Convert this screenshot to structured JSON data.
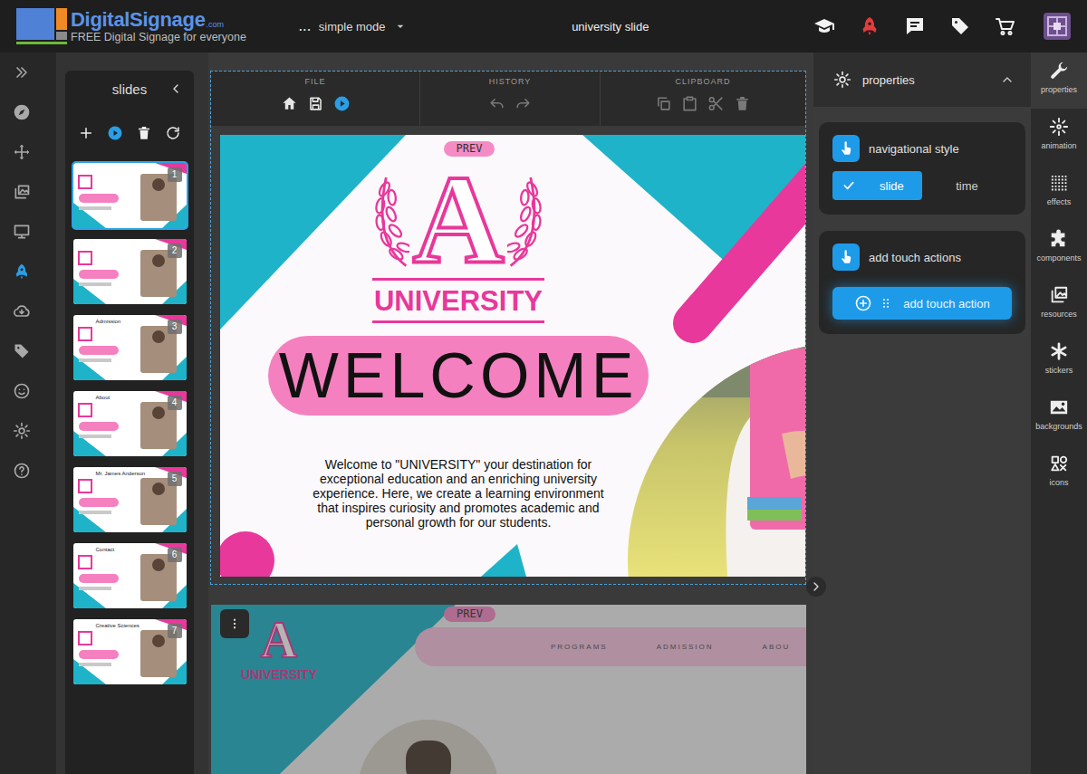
{
  "app": {
    "brand": "DigitalSignage",
    "brand_suffix": ".com",
    "tagline": "FREE Digital Signage for everyone",
    "mode_dots": "...",
    "mode": "simple mode",
    "title": "university slide"
  },
  "nav_rail": {
    "items": [
      {
        "selected": false
      },
      {
        "selected": false
      },
      {
        "selected": false
      },
      {
        "selected": false
      },
      {
        "selected": true
      },
      {
        "selected": false
      },
      {
        "selected": false
      },
      {
        "selected": false
      },
      {
        "selected": false
      },
      {
        "selected": false
      }
    ]
  },
  "slides_panel": {
    "title": "slides",
    "slides": [
      {
        "number": "1",
        "selected": true
      },
      {
        "number": "2",
        "selected": false
      },
      {
        "number": "3",
        "title": "Admission",
        "selected": false
      },
      {
        "number": "4",
        "title": "About",
        "selected": false
      },
      {
        "number": "5",
        "title": "Mr. James Anderson",
        "selected": false
      },
      {
        "number": "6",
        "title": "Contact",
        "selected": false
      },
      {
        "number": "7",
        "title": "Creative Sciences",
        "selected": false
      }
    ]
  },
  "toolbar": {
    "groups": [
      {
        "label": "FILE",
        "buttons": [
          {
            "disabled": false
          },
          {
            "disabled": false
          },
          {
            "disabled": false
          }
        ]
      },
      {
        "label": "HISTORY",
        "buttons": [
          {
            "disabled": true
          },
          {
            "disabled": true
          }
        ]
      },
      {
        "label": "CLIPBOARD",
        "buttons": [
          {
            "disabled": true
          },
          {
            "disabled": true
          },
          {
            "disabled": true
          },
          {
            "disabled": true
          }
        ]
      }
    ]
  },
  "canvas": {
    "slides": [
      {
        "selected": true,
        "prev": "PREV",
        "logo_letter": "A",
        "name": "UNIVERSITY",
        "headline": "WELCOME",
        "body": "Welcome to \"UNIVERSITY\" your destination for exceptional education and an enriching university experience. Here, we create a learning environment that inspires curiosity and promotes academic and personal growth for our students."
      },
      {
        "selected": false,
        "prev": "PREV",
        "logo_letter": "A",
        "name": "UNIVERSITY",
        "nav": [
          "PROGRAMS",
          "ADMISSION",
          "ABOU"
        ]
      }
    ]
  },
  "properties": {
    "title": "properties",
    "navigation": {
      "title": "navigational style",
      "options": [
        {
          "label": "slide",
          "selected": true
        },
        {
          "label": "time",
          "selected": false
        }
      ]
    },
    "touch": {
      "title": "add touch actions",
      "button": "add touch action"
    }
  },
  "tool_rail": [
    {
      "label": "properties",
      "selected": true
    },
    {
      "label": "animation",
      "selected": false
    },
    {
      "label": "effects",
      "selected": false
    },
    {
      "label": "components",
      "selected": false
    },
    {
      "label": "resources",
      "selected": false
    },
    {
      "label": "stickers",
      "selected": false
    },
    {
      "label": "backgrounds",
      "selected": false
    },
    {
      "label": "icons",
      "selected": false
    }
  ]
}
